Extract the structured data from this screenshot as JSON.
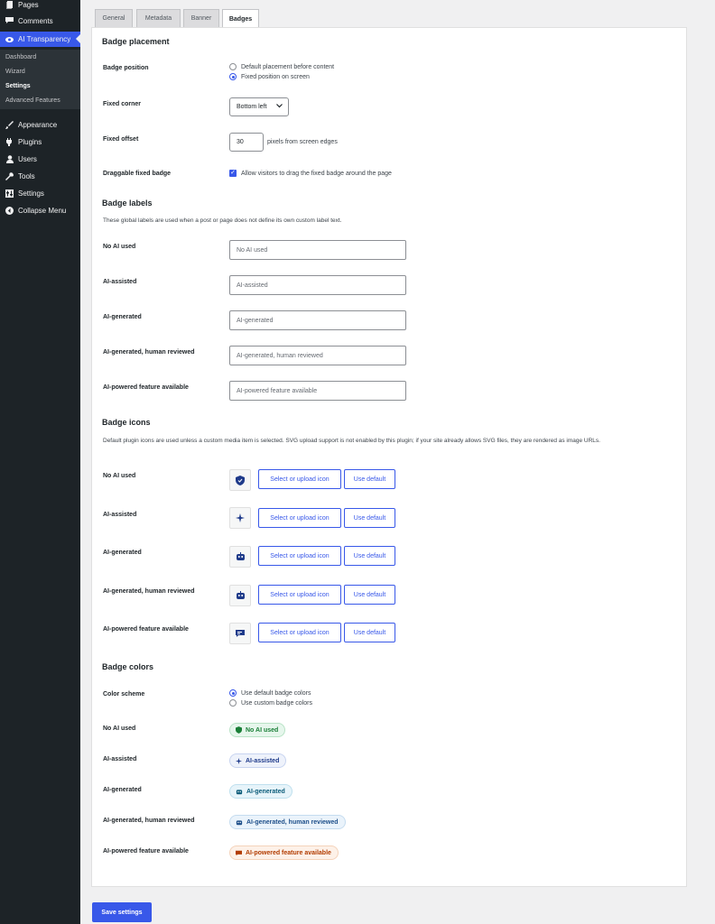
{
  "sidebar": {
    "items": [
      {
        "label": "Pages",
        "icon": "pages-icon"
      },
      {
        "label": "Comments",
        "icon": "comments-icon"
      },
      {
        "label": "AI Transparency",
        "icon": "eye-icon"
      },
      {
        "label": "Appearance",
        "icon": "brush-icon"
      },
      {
        "label": "Plugins",
        "icon": "plugin-icon"
      },
      {
        "label": "Users",
        "icon": "user-icon"
      },
      {
        "label": "Tools",
        "icon": "wrench-icon"
      },
      {
        "label": "Settings",
        "icon": "settings-icon"
      },
      {
        "label": "Collapse Menu",
        "icon": "collapse-icon"
      }
    ],
    "submenu": [
      "Dashboard",
      "Wizard",
      "Settings",
      "Advanced Features"
    ],
    "accent": "#3858e9"
  },
  "tabs": [
    "General",
    "Metadata",
    "Banner",
    "Badges"
  ],
  "placement": {
    "title": "Badge placement",
    "position_label": "Badge position",
    "position_options": [
      "Default placement before content",
      "Fixed position on screen"
    ],
    "corner_label": "Fixed corner",
    "corner_value": "Bottom left",
    "offset_label": "Fixed offset",
    "offset_value": "30",
    "offset_suffix": "pixels from screen edges",
    "draggable_label": "Draggable fixed badge",
    "draggable_text": "Allow visitors to drag the fixed badge around the page"
  },
  "labels": {
    "title": "Badge labels",
    "desc": "These global labels are used when a post or page does not define its own custom label text.",
    "fields": [
      {
        "label": "No AI used",
        "placeholder": "No AI used"
      },
      {
        "label": "AI-assisted",
        "placeholder": "AI-assisted"
      },
      {
        "label": "AI-generated",
        "placeholder": "AI-generated"
      },
      {
        "label": "AI-generated, human reviewed",
        "placeholder": "AI-generated, human reviewed"
      },
      {
        "label": "AI-powered feature available",
        "placeholder": "AI-powered feature available"
      }
    ]
  },
  "icons": {
    "title": "Badge icons",
    "desc": "Default plugin icons are used unless a custom media item is selected. SVG upload support is not enabled by this plugin; if your site already allows SVG files, they are rendered as image URLs.",
    "select_label": "Select or upload icon",
    "default_label": "Use default",
    "rows": [
      {
        "label": "No AI used",
        "icon": "shield-icon"
      },
      {
        "label": "AI-assisted",
        "icon": "sparkle-icon"
      },
      {
        "label": "AI-generated",
        "icon": "robot-icon"
      },
      {
        "label": "AI-generated, human reviewed",
        "icon": "robot-icon"
      },
      {
        "label": "AI-powered feature available",
        "icon": "chat-icon"
      }
    ]
  },
  "colors": {
    "title": "Badge colors",
    "scheme_label": "Color scheme",
    "scheme_options": [
      "Use default badge colors",
      "Use custom badge colors"
    ],
    "rows": [
      {
        "label": "No AI used",
        "badge": "No AI used",
        "fg": "#1a7f37",
        "bg": "#e6f6ec",
        "border": "#b8e3c6"
      },
      {
        "label": "AI-assisted",
        "badge": "AI-assisted",
        "fg": "#1e3a8a",
        "bg": "#eef2fb",
        "border": "#c8d4f0"
      },
      {
        "label": "AI-generated",
        "badge": "AI-generated",
        "fg": "#0b5c7a",
        "bg": "#e7f4fa",
        "border": "#bfe0ee"
      },
      {
        "label": "AI-generated, human reviewed",
        "badge": "AI-generated, human reviewed",
        "fg": "#1e4f8a",
        "bg": "#eaf3fb",
        "border": "#c5dcef"
      },
      {
        "label": "AI-powered feature available",
        "badge": "AI-powered feature available",
        "fg": "#b23c00",
        "bg": "#fdf1e8",
        "border": "#f4d3bb"
      }
    ]
  },
  "save_label": "Save settings"
}
